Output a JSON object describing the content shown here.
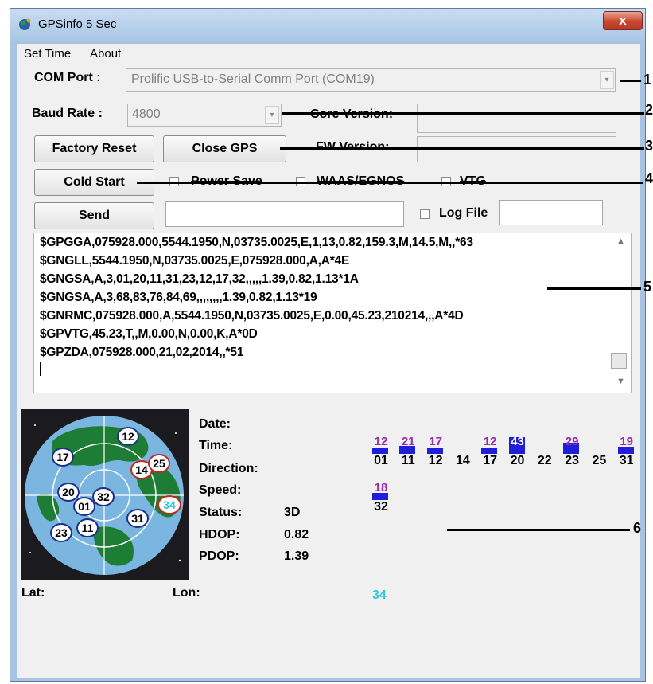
{
  "window": {
    "title": "GPSinfo  5 Sec",
    "close_glyph": "x"
  },
  "menu": {
    "items": [
      "Set Time",
      "About"
    ]
  },
  "com_port": {
    "label": "COM Port :",
    "value": "Prolific USB-to-Serial Comm Port (COM19)"
  },
  "baud_rate": {
    "label": "Baud Rate :",
    "value": "4800"
  },
  "core_version": {
    "label": "Core Version:",
    "value": ""
  },
  "fw_version": {
    "label": "FW Version:",
    "value": ""
  },
  "buttons": {
    "factory_reset": "Factory Reset",
    "close_gps": "Close GPS",
    "cold_start": "Cold Start",
    "send": "Send"
  },
  "checkboxes": {
    "power_save": "Power Save",
    "waas": "WAAS/EGNOS",
    "vtg": "VTG",
    "log_file": "Log File"
  },
  "send_input": {
    "value": ""
  },
  "log_file_input": {
    "value": ""
  },
  "nmea": [
    "$GPGGA,075928.000,5544.1950,N,03735.0025,E,1,13,0.82,159.3,M,14.5,M,,*63",
    "$GNGLL,5544.1950,N,03735.0025,E,075928.000,A,A*4E",
    "$GNGSA,A,3,01,20,11,31,23,12,17,32,,,,,1.39,0.82,1.13*1A",
    "$GNGSA,A,3,68,83,76,84,69,,,,,,,,1.39,0.82,1.13*19",
    "$GNRMC,075928.000,A,5544.1950,N,03735.0025,E,0.00,45.23,210214,,,A*4D",
    "$GPVTG,45.23,T,,M,0.00,N,0.00,K,A*0D",
    "$GPZDA,075928.000,21,02,2014,,*51"
  ],
  "info": {
    "date_label": "Date:",
    "time_label": "Time:",
    "direction_label": "Direction:",
    "speed_label": "Speed:",
    "status_label": "Status:",
    "status_value": "3D",
    "hdop_label": "HDOP:",
    "hdop_value": "0.82",
    "pdop_label": "PDOP:",
    "pdop_value": "1.39",
    "lat_label": "Lat:",
    "lon_label": "Lon:"
  },
  "sky_sats": [
    "12",
    "17",
    "14",
    "25",
    "20",
    "32",
    "01",
    "34",
    "31",
    "23",
    "11"
  ],
  "snr_row1": [
    {
      "prn": "01",
      "snr": "12"
    },
    {
      "prn": "11",
      "snr": "21"
    },
    {
      "prn": "12",
      "snr": "17"
    },
    {
      "prn": "14",
      "snr": ""
    },
    {
      "prn": "17",
      "snr": "12"
    },
    {
      "prn": "20",
      "snr": "43"
    },
    {
      "prn": "22",
      "snr": ""
    },
    {
      "prn": "23",
      "snr": "29"
    },
    {
      "prn": "25",
      "snr": ""
    },
    {
      "prn": "31",
      "snr": "19"
    }
  ],
  "snr_row2": [
    {
      "prn": "32",
      "snr": "18"
    }
  ],
  "extra_sat": "34",
  "callouts": [
    "1",
    "2",
    "3",
    "4",
    "5",
    "6"
  ],
  "colors": {
    "snr_bar": "#1f1fd9",
    "snr_text": "#9a2bb0",
    "extra_sat": "#2ec7d6",
    "close_button": "#c8472f"
  },
  "icons": {
    "app": "satellite-globe-icon",
    "checkbox": "checkbox-icon"
  }
}
